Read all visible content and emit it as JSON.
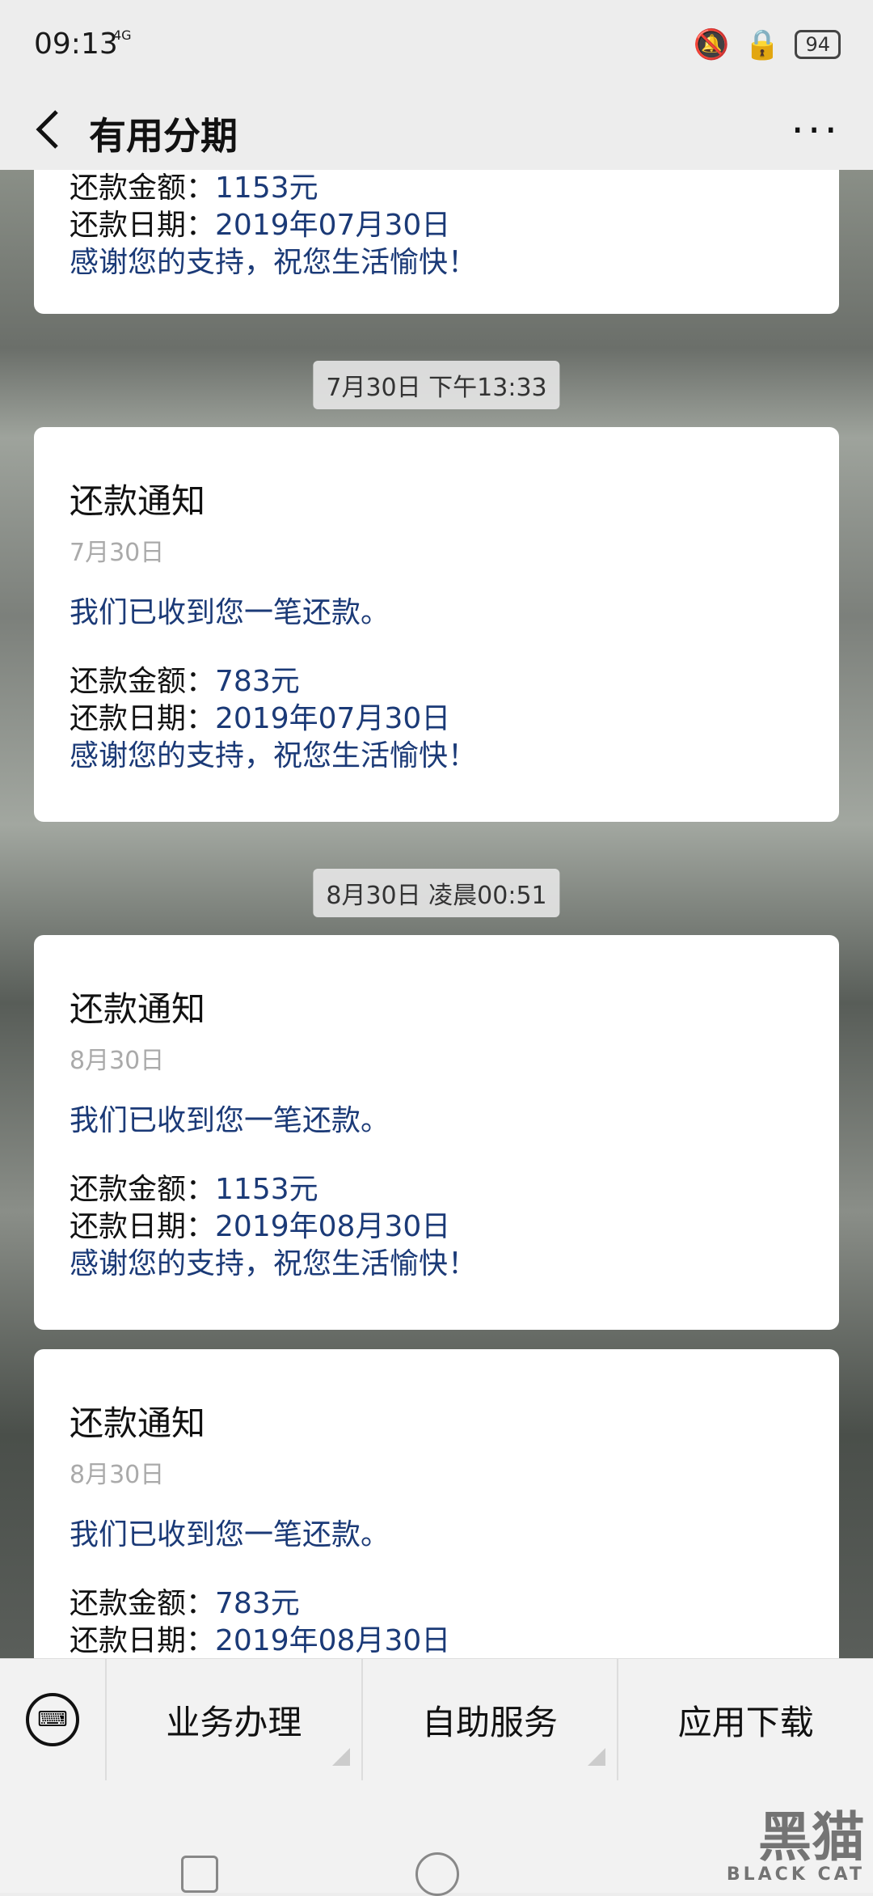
{
  "status": {
    "time": "09:13",
    "network": "4G",
    "battery": "94"
  },
  "header": {
    "title": "有用分期"
  },
  "partial_top": {
    "amount_label": "还款金额：",
    "amount": "1153元",
    "date_label": "还款日期：",
    "date": "2019年07月30日",
    "thanks": "感谢您的支持，祝您生活愉快！"
  },
  "timestamps": [
    "7月30日 下午13:33",
    "8月30日 凌晨00:51"
  ],
  "cards": [
    {
      "title": "还款通知",
      "date": "7月30日",
      "intro": "我们已收到您一笔还款。",
      "amount_label": "还款金额：",
      "amount": "783元",
      "date_label": "还款日期：",
      "repay_date": "2019年07月30日",
      "thanks": "感谢您的支持，祝您生活愉快！"
    },
    {
      "title": "还款通知",
      "date": "8月30日",
      "intro": "我们已收到您一笔还款。",
      "amount_label": "还款金额：",
      "amount": "1153元",
      "date_label": "还款日期：",
      "repay_date": "2019年08月30日",
      "thanks": "感谢您的支持，祝您生活愉快！"
    },
    {
      "title": "还款通知",
      "date": "8月30日",
      "intro": "我们已收到您一笔还款。",
      "amount_label": "还款金额：",
      "amount": "783元",
      "date_label": "还款日期：",
      "repay_date": "2019年08月30日"
    }
  ],
  "menu": [
    "业务办理",
    "自助服务",
    "应用下载"
  ],
  "watermark": {
    "cn": "黑猫",
    "en": "BLACK CAT"
  }
}
